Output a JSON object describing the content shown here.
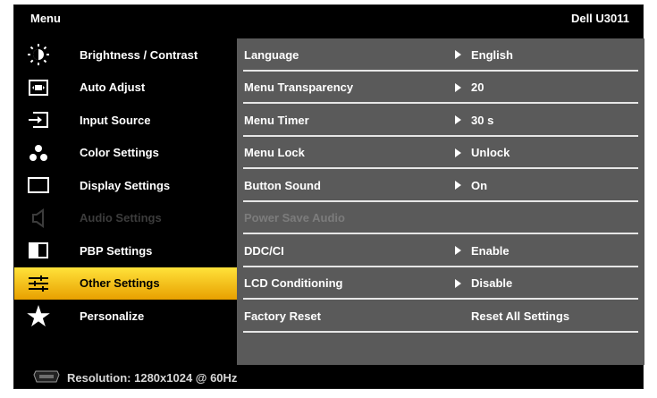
{
  "header": {
    "menu_label": "Menu",
    "model": "Dell U3011"
  },
  "sidebar": {
    "items": [
      {
        "label": "Brightness / Contrast",
        "icon": "brightness-icon"
      },
      {
        "label": "Auto Adjust",
        "icon": "auto-adjust-icon"
      },
      {
        "label": "Input Source",
        "icon": "input-source-icon"
      },
      {
        "label": "Color Settings",
        "icon": "color-settings-icon"
      },
      {
        "label": "Display Settings",
        "icon": "display-settings-icon"
      },
      {
        "label": "Audio Settings",
        "icon": "speaker-icon",
        "state": "disabled"
      },
      {
        "label": "PBP Settings",
        "icon": "pbp-icon"
      },
      {
        "label": "Other Settings",
        "icon": "sliders-icon",
        "state": "selected"
      },
      {
        "label": "Personalize",
        "icon": "star-icon"
      }
    ]
  },
  "panel": {
    "rows": [
      {
        "label": "Language",
        "value": "English"
      },
      {
        "label": "Menu Transparency",
        "value": "20"
      },
      {
        "label": "Menu Timer",
        "value": "30 s"
      },
      {
        "label": "Menu Lock",
        "value": "Unlock"
      },
      {
        "label": "Button Sound",
        "value": "On"
      },
      {
        "label": "Power Save Audio",
        "value": ""
      },
      {
        "label": "DDC/CI",
        "value": "Enable"
      },
      {
        "label": "LCD Conditioning",
        "value": "Disable"
      },
      {
        "label": "Factory Reset",
        "value": "Reset All Settings"
      }
    ]
  },
  "status": {
    "resolution": "Resolution: 1280x1024 @ 60Hz"
  },
  "colors": {
    "background": "#000000",
    "panel": "#5a5a5a",
    "selected_top": "#ffe23a",
    "selected_bottom": "#e8a000",
    "disabled_text": "#3c3c3c"
  }
}
